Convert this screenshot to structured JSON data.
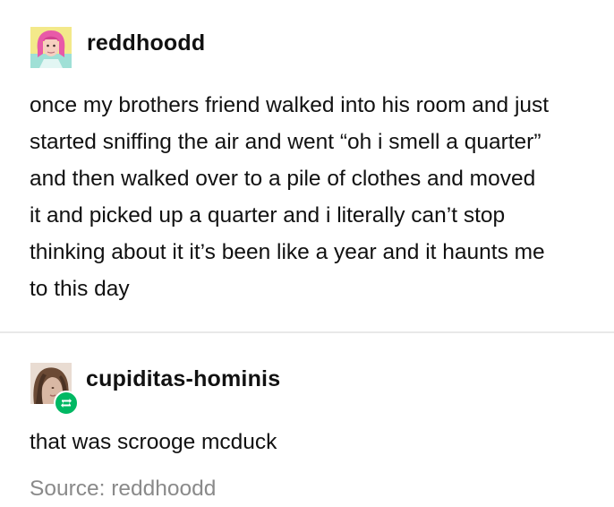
{
  "post": {
    "username": "reddhoodd",
    "avatar_icon": "pink-hair-avatar-icon",
    "lines": [
      "once my brothers friend walked into his room and just",
      "started sniffing the air and went “oh i smell a quarter”",
      "and then walked over to a pile of clothes and moved",
      "it and picked up a quarter and i literally can’t stop",
      "thinking about it it’s been like a year and it haunts me",
      "to this day"
    ]
  },
  "reblog": {
    "username": "cupiditas-hominis",
    "avatar_icon": "photo-avatar-icon",
    "badge_icon": "reblog-icon",
    "badge_color": "#00b863",
    "text": "that was scrooge mcduck",
    "source_label": "Source: reddhoodd"
  }
}
